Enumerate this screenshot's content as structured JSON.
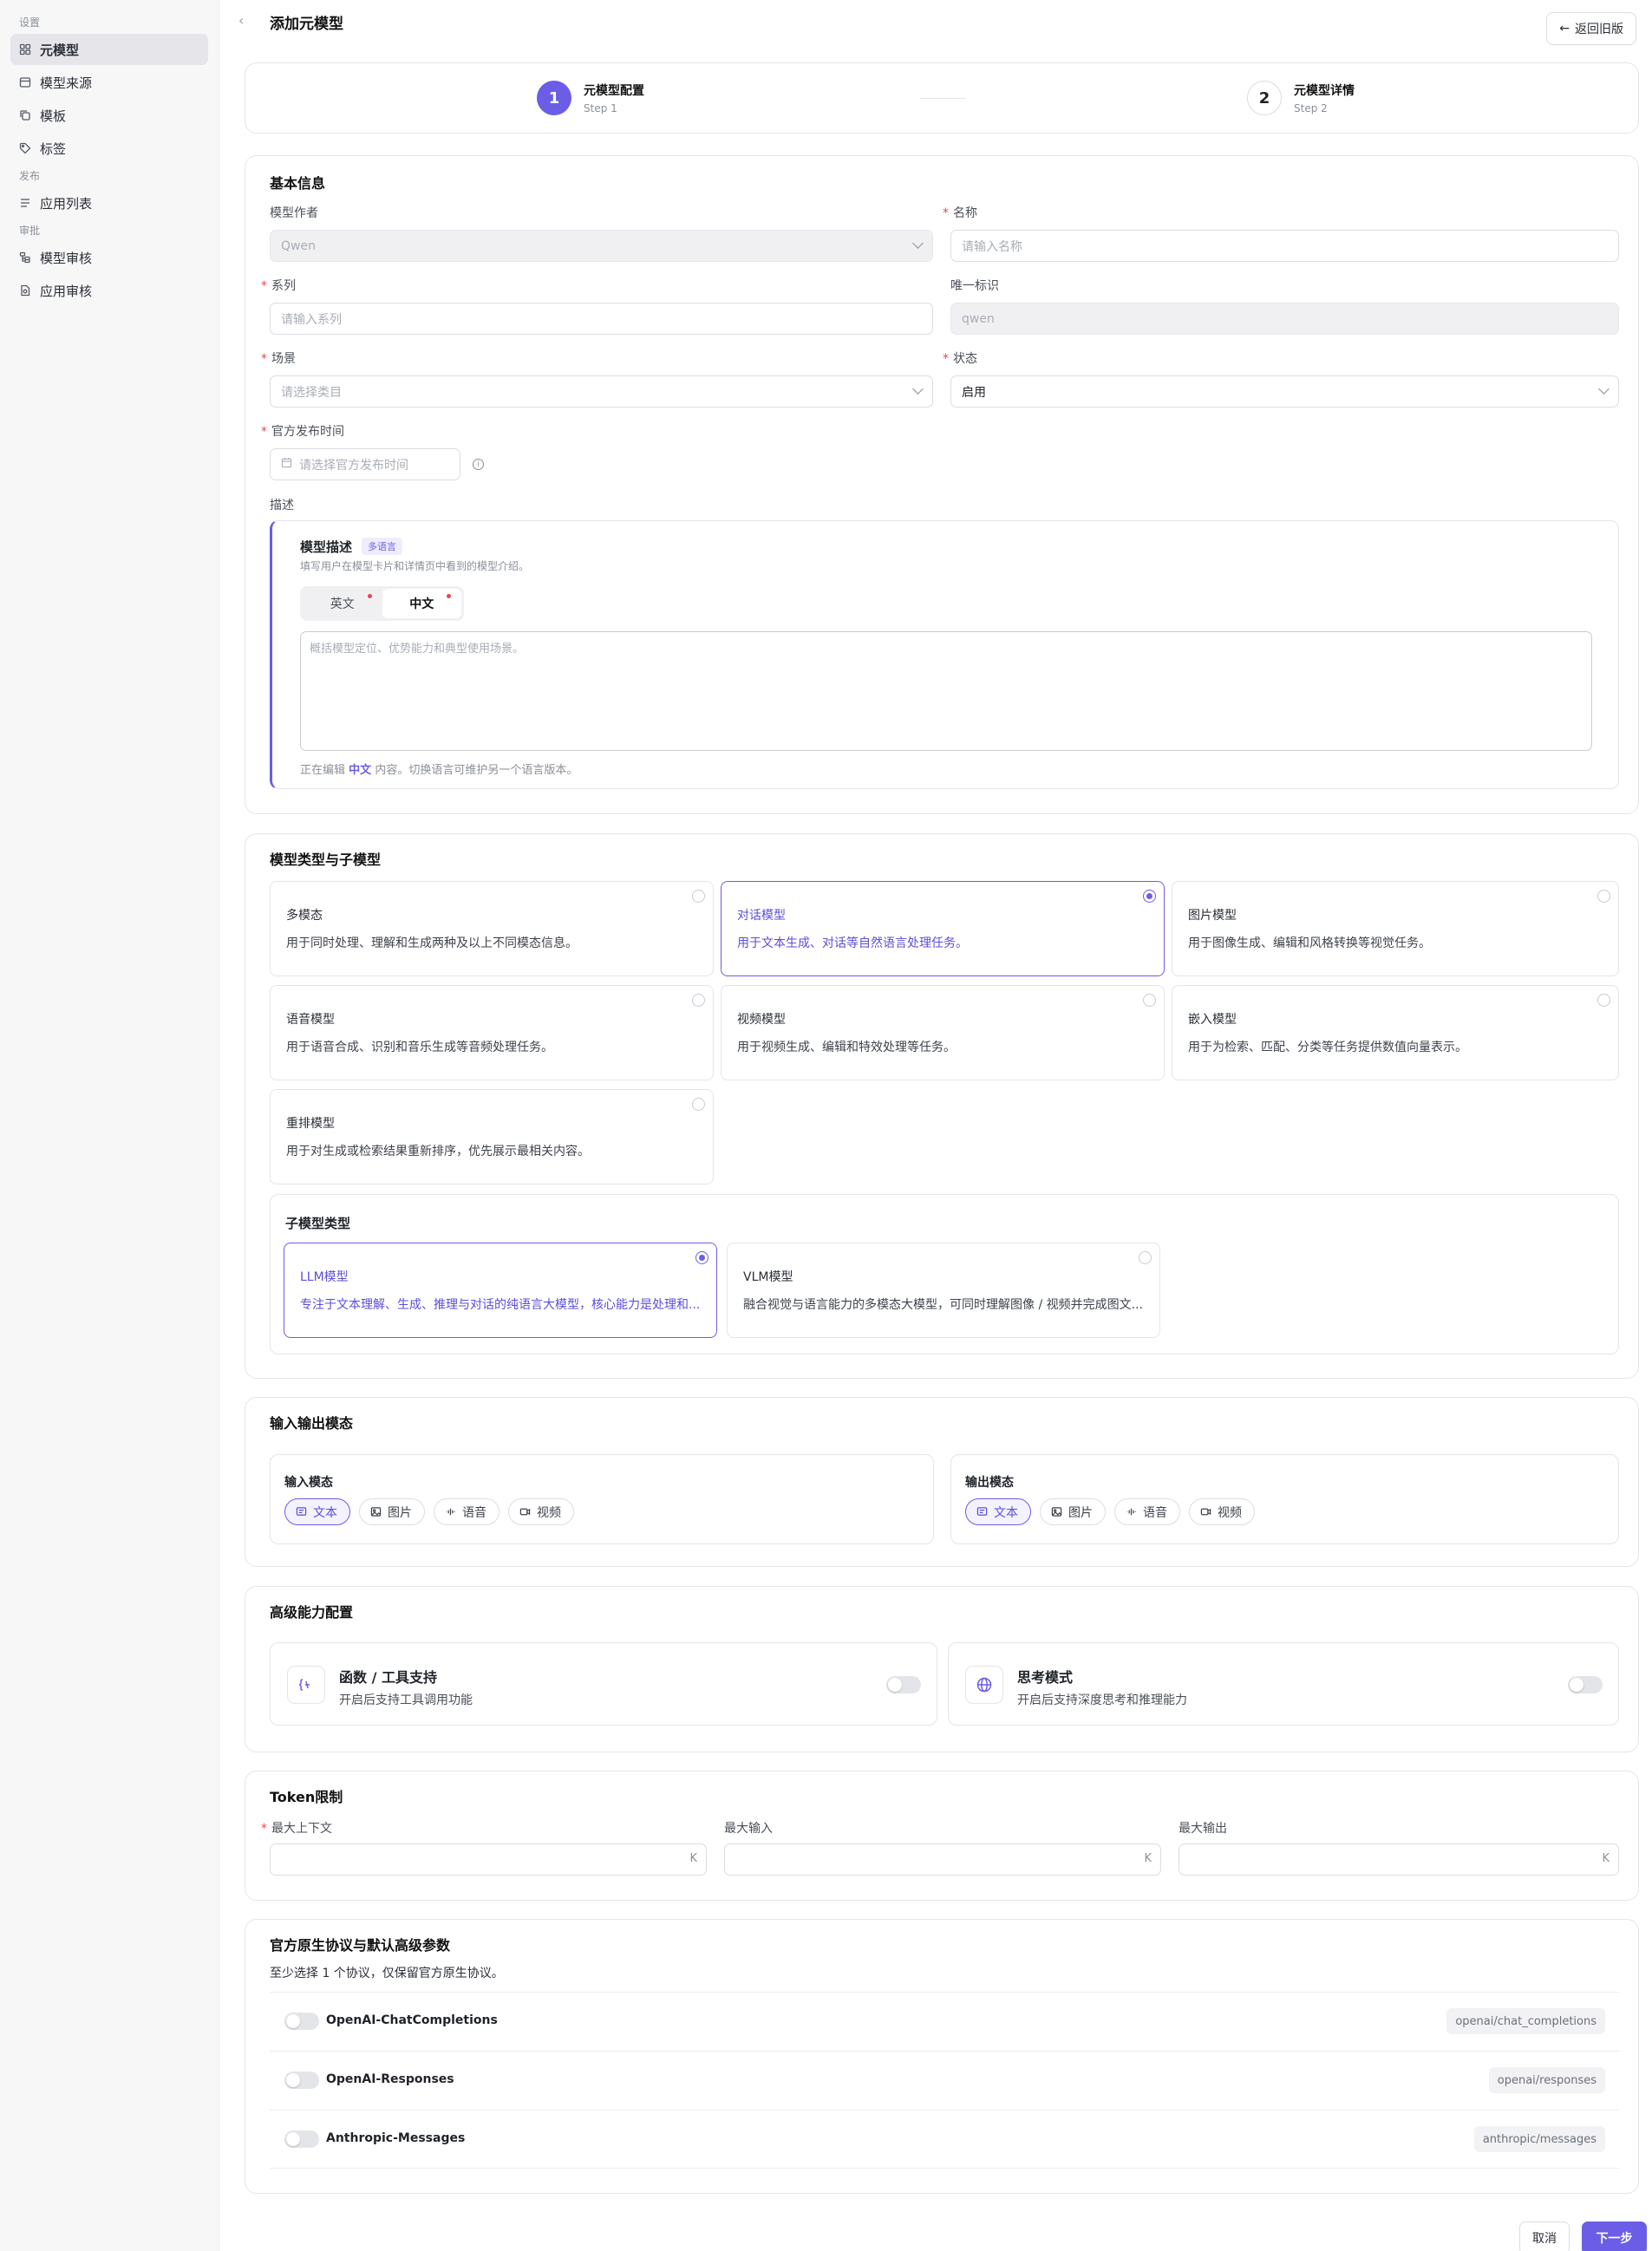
{
  "sidebar": {
    "groups": [
      {
        "label": "设置",
        "items": [
          {
            "label": "元模型",
            "icon": "grid-icon",
            "active": true
          },
          {
            "label": "模型来源",
            "icon": "database-icon"
          },
          {
            "label": "模板",
            "icon": "copy-icon"
          },
          {
            "label": "标签",
            "icon": "tag-icon"
          }
        ]
      },
      {
        "label": "发布",
        "items": [
          {
            "label": "应用列表",
            "icon": "list-icon"
          }
        ]
      },
      {
        "label": "审批",
        "items": [
          {
            "label": "模型审核",
            "icon": "tree-icon"
          },
          {
            "label": "应用审核",
            "icon": "file-icon"
          }
        ]
      }
    ]
  },
  "header": {
    "title": "添加元模型",
    "back_old": "返回旧版"
  },
  "steps": [
    {
      "num": "1",
      "label": "元模型配置",
      "sub": "Step 1",
      "active": true
    },
    {
      "num": "2",
      "label": "元模型详情",
      "sub": "Step 2",
      "active": false
    }
  ],
  "basic": {
    "title": "基本信息",
    "author_label": "模型作者",
    "author_value": "Qwen",
    "name_label": "名称",
    "name_placeholder": "请输入名称",
    "series_label": "系列",
    "series_placeholder": "请输入系列",
    "uid_label": "唯一标识",
    "uid_value": "qwen",
    "scene_label": "场景",
    "scene_placeholder": "请选择类目",
    "status_label": "状态",
    "status_value": "启用",
    "release_label": "官方发布时间",
    "release_placeholder": "请选择官方发布时间",
    "desc_label": "描述",
    "desc": {
      "title": "模型描述",
      "badge": "多语言",
      "sub": "填写用户在模型卡片和详情页中看到的模型介绍。",
      "tabs": [
        "英文",
        "中文"
      ],
      "active_tab": "中文",
      "placeholder": "概括模型定位、优势能力和典型使用场景。",
      "foot_pre": "正在编辑",
      "foot_lang": "中文",
      "foot_post": "内容。切换语言可维护另一个语言版本。"
    }
  },
  "types": {
    "title": "模型类型与子模型",
    "options": [
      {
        "title": "多模态",
        "desc": "用于同时处理、理解和生成两种及以上不同模态信息。",
        "selected": false
      },
      {
        "title": "对话模型",
        "desc": "用于文本生成、对话等自然语言处理任务。",
        "selected": true
      },
      {
        "title": "图片模型",
        "desc": "用于图像生成、编辑和风格转换等视觉任务。",
        "selected": false
      },
      {
        "title": "语音模型",
        "desc": "用于语音合成、识别和音乐生成等音频处理任务。",
        "selected": false
      },
      {
        "title": "视频模型",
        "desc": "用于视频生成、编辑和特效处理等任务。",
        "selected": false
      },
      {
        "title": "嵌入模型",
        "desc": "用于为检索、匹配、分类等任务提供数值向量表示。",
        "selected": false
      },
      {
        "title": "重排模型",
        "desc": "用于对生成或检索结果重新排序，优先展示最相关内容。",
        "selected": false
      }
    ],
    "sub_title": "子模型类型",
    "sub_options": [
      {
        "title": "LLM模型",
        "desc": "专注于文本理解、生成、推理与对话的纯语言大模型，核心能力是处理和...",
        "selected": true
      },
      {
        "title": "VLM模型",
        "desc": "融合视觉与语言能力的多模态大模型，可同时理解图像 / 视频并完成图文...",
        "selected": false
      }
    ]
  },
  "io": {
    "title": "输入输出模态",
    "input_title": "输入模态",
    "output_title": "输出模态",
    "chips": [
      {
        "label": "文本",
        "icon": "text-icon",
        "on": true
      },
      {
        "label": "图片",
        "icon": "image-icon",
        "on": false
      },
      {
        "label": "语音",
        "icon": "audio-icon",
        "on": false
      },
      {
        "label": "视频",
        "icon": "video-icon",
        "on": false
      }
    ]
  },
  "advanced": {
    "title": "高级能力配置",
    "items": [
      {
        "title": "函数 / 工具支持",
        "desc": "开启后支持工具调用功能",
        "icon": "tool-icon",
        "on": false
      },
      {
        "title": "思考模式",
        "desc": "开启后支持深度思考和推理能力",
        "icon": "globe-icon",
        "on": false
      }
    ]
  },
  "token": {
    "title": "Token限制",
    "fields": [
      {
        "label": "最大上下文",
        "required": true,
        "suffix": "K"
      },
      {
        "label": "最大输入",
        "required": false,
        "suffix": "K"
      },
      {
        "label": "最大输出",
        "required": false,
        "suffix": "K"
      }
    ]
  },
  "protocols": {
    "title": "官方原生协议与默认高级参数",
    "sub": "至少选择 1 个协议，仅保留官方原生协议。",
    "rows": [
      {
        "name": "OpenAI-ChatCompletions",
        "tag": "openai/chat_completions",
        "on": false
      },
      {
        "name": "OpenAI-Responses",
        "tag": "openai/responses",
        "on": false
      },
      {
        "name": "Anthropic-Messages",
        "tag": "anthropic/messages",
        "on": false
      }
    ]
  },
  "footer": {
    "cancel": "取消",
    "next": "下一步"
  },
  "colors": {
    "accent": "#6b5de6",
    "required": "#e5484d"
  }
}
